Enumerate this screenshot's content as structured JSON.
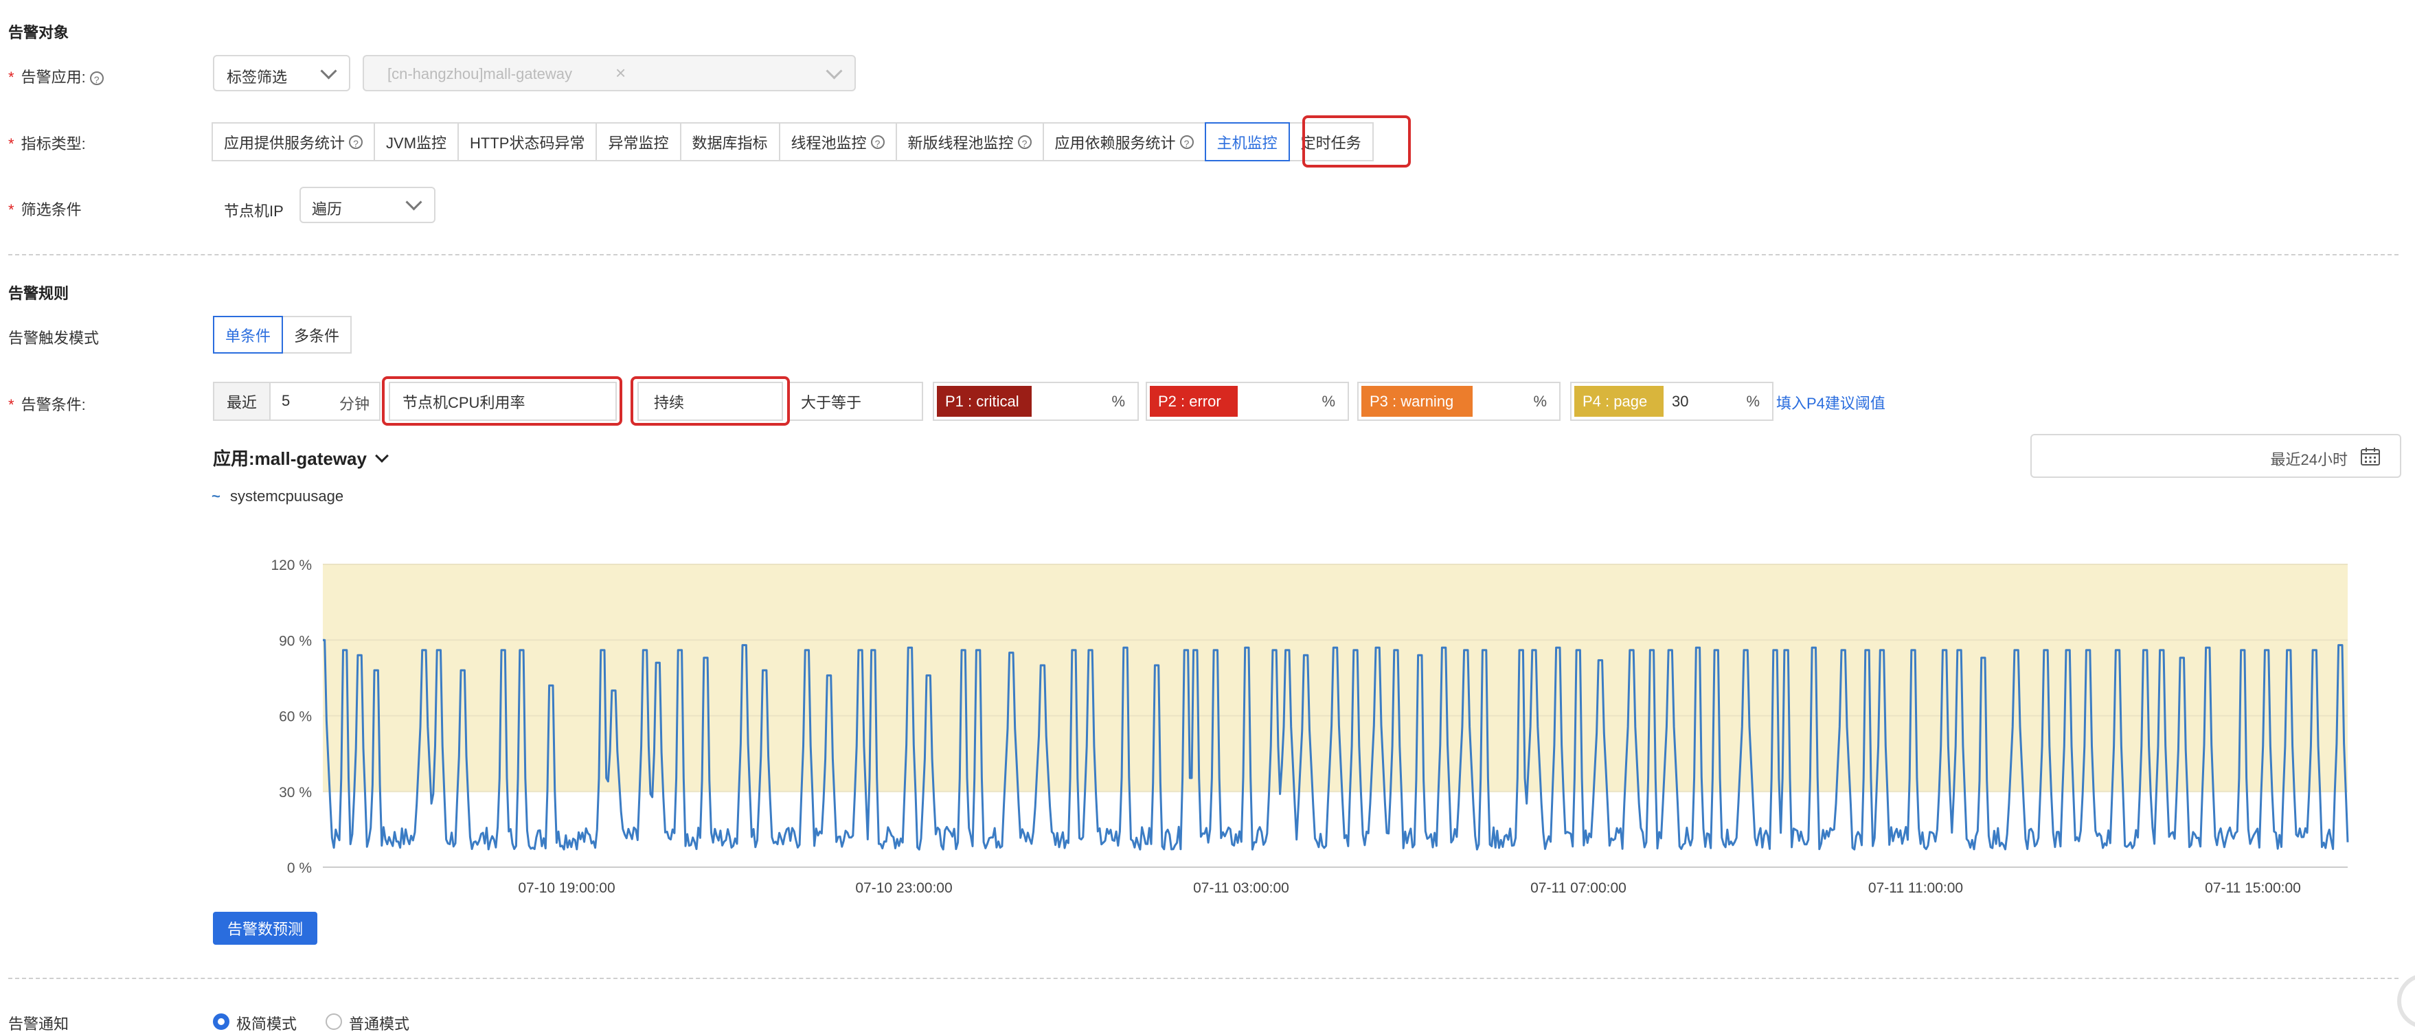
{
  "target_section": {
    "title": "告警对象"
  },
  "app_field": {
    "label": "告警应用:",
    "help": "?",
    "filter_select": "标签筛选",
    "app_value": "[cn-hangzhou]mall-gateway",
    "clear": "×"
  },
  "metric_field": {
    "label": "指标类型:",
    "tabs": [
      {
        "label": "应用提供服务统计",
        "help": "?"
      },
      {
        "label": "JVM监控"
      },
      {
        "label": "HTTP状态码异常"
      },
      {
        "label": "异常监控"
      },
      {
        "label": "数据库指标"
      },
      {
        "label": "线程池监控",
        "help": "?"
      },
      {
        "label": "新版线程池监控",
        "help": "?"
      },
      {
        "label": "应用依赖服务统计",
        "help": "?"
      },
      {
        "label": "主机监控",
        "active": true
      },
      {
        "label": "定时任务"
      }
    ]
  },
  "filter_field": {
    "label": "筛选条件",
    "dim_label": "节点机IP",
    "dim_value": "遍历"
  },
  "rule_section": {
    "title": "告警规则"
  },
  "trigger_mode": {
    "label": "告警触发模式",
    "options": [
      "单条件",
      "多条件"
    ],
    "selected": "单条件"
  },
  "condition": {
    "label": "告警条件:",
    "recent_label": "最近",
    "minutes_value": "5",
    "minutes_unit": "分钟",
    "metric": "节点机CPU利用率",
    "aggregation": "持续",
    "operator": "大于等于",
    "levels": [
      {
        "badge": "P1 : critical",
        "color": "#9b1e16",
        "value": "",
        "unit": "%"
      },
      {
        "badge": "P2 : error",
        "color": "#d8281f",
        "value": "",
        "unit": "%"
      },
      {
        "badge": "P3 : warning",
        "color": "#ec7d2c",
        "value": "",
        "unit": "%"
      },
      {
        "badge": "P4 : page",
        "color": "#d9b53c",
        "value": "30",
        "unit": "%"
      }
    ],
    "suggest_link": "填入P4建议阈值"
  },
  "chart_header": {
    "app_label": "应用:",
    "app_name": "mall-gateway",
    "time_range": "最近24小时"
  },
  "chart_data": {
    "type": "line",
    "series": [
      {
        "name": "systemcpuusage",
        "color": "#3b7cc4"
      }
    ],
    "y_ticks": [
      "120 %",
      "90 %",
      "60 %",
      "30 %",
      "0 %"
    ],
    "ylim": [
      0,
      120
    ],
    "x_ticks": [
      "07-10 19:00:00",
      "07-10 23:00:00",
      "07-11 03:00:00",
      "07-11 07:00:00",
      "07-11 11:00:00",
      "07-11 15:00:00"
    ],
    "threshold": {
      "value": 30,
      "band_color": "#f8f0cd"
    },
    "spikes": [
      {
        "t": 0.0,
        "v": 90
      },
      {
        "t": 0.011,
        "v": 86
      },
      {
        "t": 0.018,
        "v": 84
      },
      {
        "t": 0.026,
        "v": 78
      },
      {
        "t": 0.05,
        "v": 86
      },
      {
        "t": 0.057,
        "v": 86
      },
      {
        "t": 0.069,
        "v": 78
      },
      {
        "t": 0.089,
        "v": 86
      },
      {
        "t": 0.098,
        "v": 86
      },
      {
        "t": 0.113,
        "v": 72
      },
      {
        "t": 0.138,
        "v": 86
      },
      {
        "t": 0.144,
        "v": 70
      },
      {
        "t": 0.159,
        "v": 86
      },
      {
        "t": 0.165,
        "v": 81
      },
      {
        "t": 0.176,
        "v": 86
      },
      {
        "t": 0.189,
        "v": 83
      },
      {
        "t": 0.208,
        "v": 88
      },
      {
        "t": 0.218,
        "v": 78
      },
      {
        "t": 0.239,
        "v": 86
      },
      {
        "t": 0.25,
        "v": 76
      },
      {
        "t": 0.265,
        "v": 86
      },
      {
        "t": 0.272,
        "v": 86
      },
      {
        "t": 0.29,
        "v": 87
      },
      {
        "t": 0.299,
        "v": 76
      },
      {
        "t": 0.316,
        "v": 86
      },
      {
        "t": 0.324,
        "v": 86
      },
      {
        "t": 0.34,
        "v": 85
      },
      {
        "t": 0.355,
        "v": 80
      },
      {
        "t": 0.371,
        "v": 86
      },
      {
        "t": 0.379,
        "v": 86
      },
      {
        "t": 0.396,
        "v": 87
      },
      {
        "t": 0.412,
        "v": 80
      },
      {
        "t": 0.426,
        "v": 86
      },
      {
        "t": 0.431,
        "v": 86
      },
      {
        "t": 0.441,
        "v": 86
      },
      {
        "t": 0.456,
        "v": 87
      },
      {
        "t": 0.47,
        "v": 86
      },
      {
        "t": 0.476,
        "v": 86
      },
      {
        "t": 0.485,
        "v": 84
      },
      {
        "t": 0.5,
        "v": 87
      },
      {
        "t": 0.51,
        "v": 86
      },
      {
        "t": 0.521,
        "v": 87
      },
      {
        "t": 0.53,
        "v": 86
      },
      {
        "t": 0.542,
        "v": 84
      },
      {
        "t": 0.554,
        "v": 87
      },
      {
        "t": 0.565,
        "v": 86
      },
      {
        "t": 0.574,
        "v": 86
      },
      {
        "t": 0.592,
        "v": 86
      },
      {
        "t": 0.598,
        "v": 86
      },
      {
        "t": 0.61,
        "v": 87
      },
      {
        "t": 0.62,
        "v": 86
      },
      {
        "t": 0.631,
        "v": 82
      },
      {
        "t": 0.646,
        "v": 86
      },
      {
        "t": 0.656,
        "v": 86
      },
      {
        "t": 0.665,
        "v": 86
      },
      {
        "t": 0.679,
        "v": 87
      },
      {
        "t": 0.688,
        "v": 86
      },
      {
        "t": 0.703,
        "v": 86
      },
      {
        "t": 0.717,
        "v": 86
      },
      {
        "t": 0.723,
        "v": 86
      },
      {
        "t": 0.736,
        "v": 87
      },
      {
        "t": 0.751,
        "v": 86
      },
      {
        "t": 0.763,
        "v": 86
      },
      {
        "t": 0.77,
        "v": 86
      },
      {
        "t": 0.785,
        "v": 86
      },
      {
        "t": 0.801,
        "v": 86
      },
      {
        "t": 0.808,
        "v": 86
      },
      {
        "t": 0.82,
        "v": 83
      },
      {
        "t": 0.836,
        "v": 86
      },
      {
        "t": 0.851,
        "v": 86
      },
      {
        "t": 0.862,
        "v": 86
      },
      {
        "t": 0.872,
        "v": 86
      },
      {
        "t": 0.886,
        "v": 86
      },
      {
        "t": 0.9,
        "v": 86
      },
      {
        "t": 0.908,
        "v": 86
      },
      {
        "t": 0.918,
        "v": 83
      },
      {
        "t": 0.931,
        "v": 87
      },
      {
        "t": 0.948,
        "v": 86
      },
      {
        "t": 0.96,
        "v": 86
      },
      {
        "t": 0.971,
        "v": 86
      },
      {
        "t": 0.984,
        "v": 86
      },
      {
        "t": 0.996,
        "v": 88
      }
    ]
  },
  "forecast_button": "告警数预测",
  "notify_section": {
    "label": "告警通知",
    "options": [
      "极简模式",
      "普通模式"
    ]
  }
}
